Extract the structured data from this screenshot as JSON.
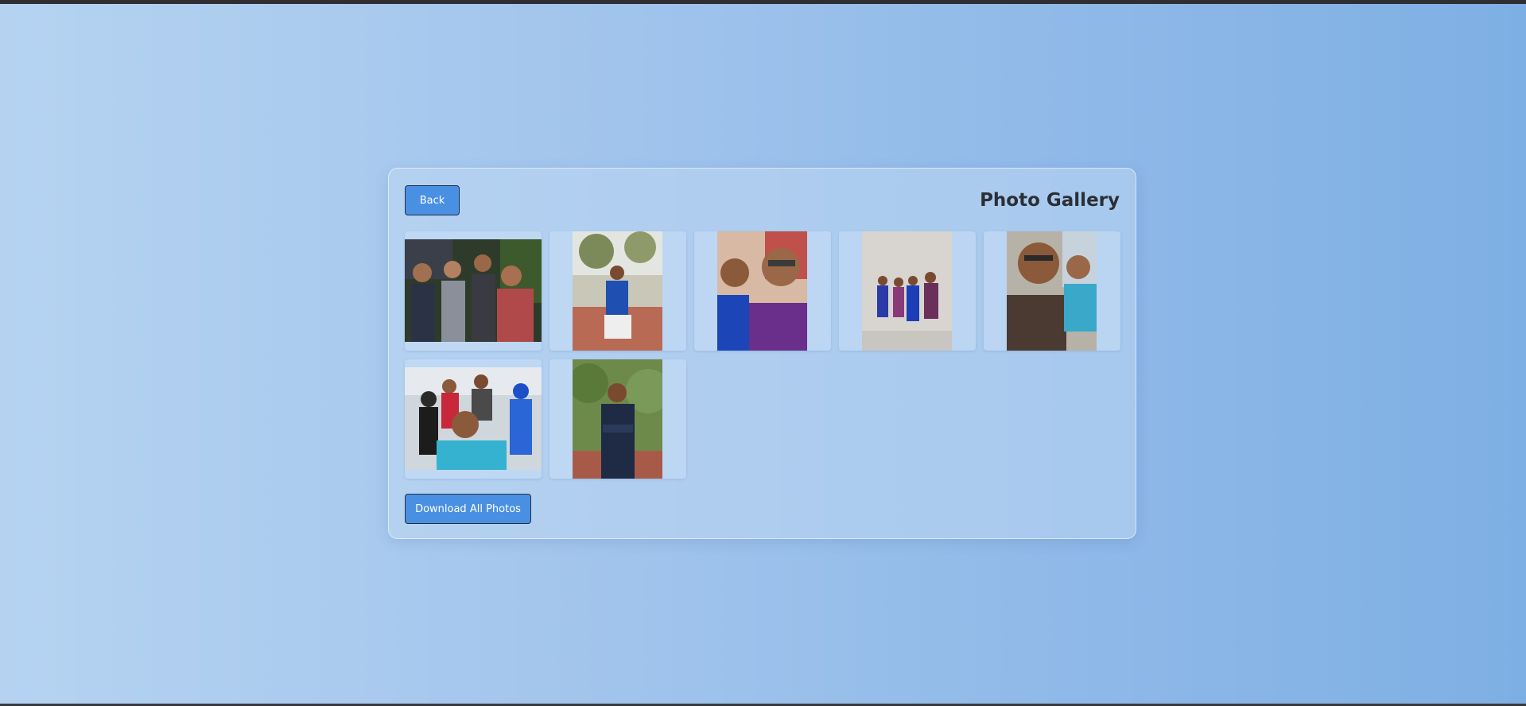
{
  "header": {
    "title": "Photo Gallery",
    "back_label": "Back"
  },
  "footer": {
    "download_label": "Download All Photos"
  },
  "gallery": {
    "photos": [
      {
        "subject": "group of four friends outdoors",
        "orientation": "landscape"
      },
      {
        "subject": "man in blue kurta sitting on brick ledge",
        "orientation": "portrait"
      },
      {
        "subject": "selfie of two young men",
        "orientation": "portrait"
      },
      {
        "subject": "four people standing in front of a patterned wall",
        "orientation": "portrait"
      },
      {
        "subject": "selfie of two men with glasses",
        "orientation": "portrait"
      },
      {
        "subject": "group selfie with friends outdoors",
        "orientation": "landscape"
      },
      {
        "subject": "man in navy kurta with arms crossed",
        "orientation": "portrait"
      }
    ]
  },
  "colors": {
    "accent": "#4a90e2",
    "title_text": "#2a2f36",
    "button_text": "#ffffff"
  }
}
